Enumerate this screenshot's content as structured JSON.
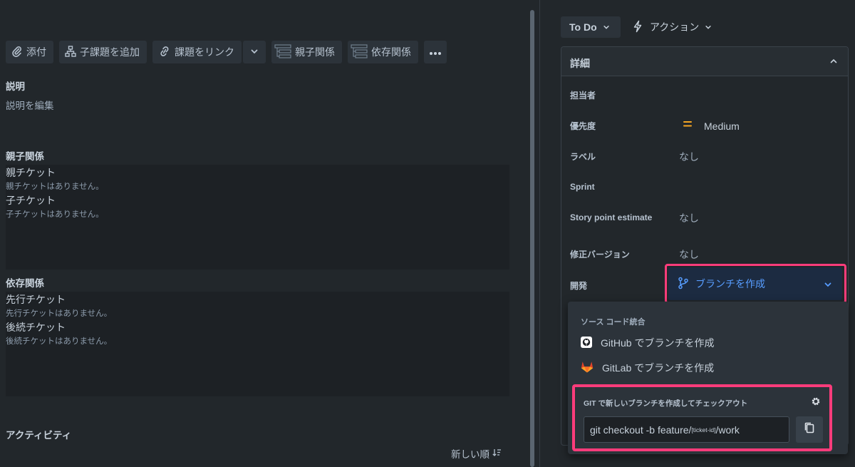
{
  "toolbar": {
    "attach": "添付",
    "add_child": "子課題を追加",
    "link_issue": "課題をリンク",
    "parent_relation": "親子関係",
    "dependency": "依存関係"
  },
  "description": {
    "title": "説明",
    "placeholder": "説明を編集"
  },
  "parent_child": {
    "title": "親子関係",
    "parent_label": "親チケット",
    "parent_empty": "親チケットはありません。",
    "child_label": "子チケット",
    "child_empty": "子チケットはありません。"
  },
  "dependencies": {
    "title": "依存関係",
    "predecessor_label": "先行チケット",
    "predecessor_empty": "先行チケットはありません。",
    "successor_label": "後続チケット",
    "successor_empty": "後続チケットはありません。"
  },
  "activity": {
    "title": "アクティビティ",
    "sort_label": "新しい順"
  },
  "header": {
    "status": "To Do",
    "action": "アクション"
  },
  "details": {
    "title": "詳細",
    "fields": {
      "assignee": "担当者",
      "priority_label": "優先度",
      "priority_value": "Medium",
      "label_label": "ラベル",
      "label_value": "なし",
      "sprint_label": "Sprint",
      "story_point_label": "Story point estimate",
      "story_point_value": "なし",
      "fix_version_label": "修正バージョン",
      "fix_version_value": "なし",
      "development_label": "開発"
    },
    "create_branch": "ブランチを作成"
  },
  "branch_menu": {
    "section_title": "ソース コード統合",
    "github_item": "GitHub でブランチを作成",
    "gitlab_item": "GitLab でブランチを作成",
    "git_title": "GIT で新しいブランチを作成してチェックアウト",
    "git_cmd_prefix": "git checkout -b feature/",
    "git_cmd_placeholder": "[ticket-id]",
    "git_cmd_suffix": "/work"
  },
  "colors": {
    "background": "#22272b",
    "accent_blue": "#579dff",
    "highlight": "#ff3c7b",
    "priority_medium": "#f5a623"
  }
}
